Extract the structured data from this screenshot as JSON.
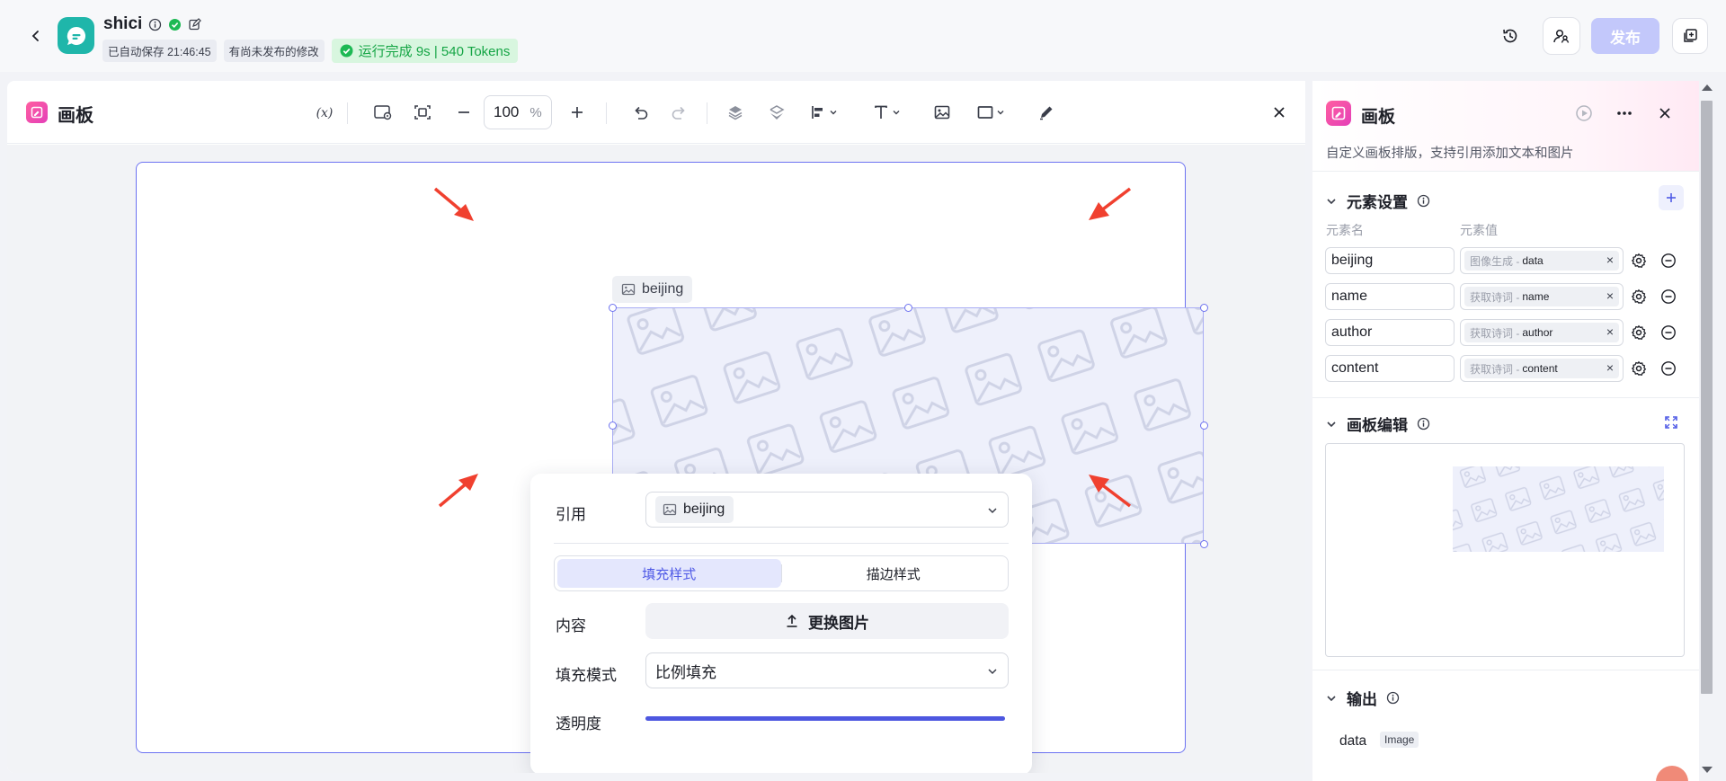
{
  "header": {
    "app_name": "shici",
    "autosave": "已自动保存 21:46:45",
    "unpublished": "有尚未发布的修改",
    "run_status": "运行完成 9s | 540 Tokens",
    "publish_label": "发布"
  },
  "canvas": {
    "title": "画板",
    "zoom_value": "100",
    "zoom_unit": "%",
    "element_label": "beijing"
  },
  "popover": {
    "ref_label": "引用",
    "ref_value": "beijing",
    "tab_fill": "填充样式",
    "tab_stroke": "描边样式",
    "content_label": "内容",
    "replace_label": "更换图片",
    "fill_mode_label": "填充模式",
    "fill_mode_value": "比例填充",
    "opacity_label": "透明度",
    "opacity_value": 1.0
  },
  "panel": {
    "title": "画板",
    "description": "自定义画板排版，支持引用添加文本和图片",
    "elements_title": "元素设置",
    "col_name": "元素名",
    "col_value": "元素值",
    "elements": [
      {
        "name": "beijing",
        "source": "图像生成 -",
        "var": "data"
      },
      {
        "name": "name",
        "source": "获取诗词 -",
        "var": "name"
      },
      {
        "name": "author",
        "source": "获取诗词 -",
        "var": "author"
      },
      {
        "name": "content",
        "source": "获取诗词 -",
        "var": "content"
      }
    ],
    "editor_title": "画板编辑",
    "output_title": "输出",
    "output_name": "data",
    "output_type": "Image"
  },
  "colors": {
    "accent": "#4f5ae6",
    "brand_teal": "#1fb6aa",
    "success": "#15a545",
    "publish_disabled": "#c3c8fb",
    "annotation_arrow": "#f0402f"
  }
}
